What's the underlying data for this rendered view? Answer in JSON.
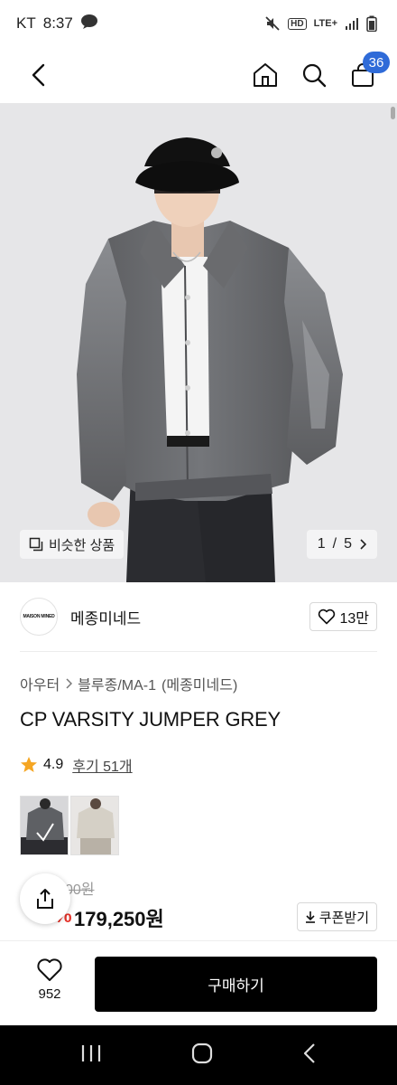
{
  "status_bar": {
    "carrier": "KT",
    "time": "8:37",
    "network": "LTE+",
    "hd": "HD"
  },
  "nav": {
    "cart_count": "36"
  },
  "hero": {
    "similar_label": "비슷한 상품",
    "page_current": "1",
    "page_sep": "/",
    "page_total": "5"
  },
  "brand": {
    "logo_text": "MAISON MINED",
    "name": "메종미네드",
    "like_count": "13만"
  },
  "breadcrumb": {
    "category": "아우터",
    "subcategory": "블루종/MA-1",
    "brand": "(메종미네드)"
  },
  "product": {
    "title": "CP VARSITY JUMPER GREY",
    "rating": "4.9",
    "review_label": "후기 51개",
    "thumbnails": [
      "grey-jacket",
      "beige-jacket"
    ]
  },
  "price": {
    "original_visible": "00원",
    "discount_visible": "%",
    "sale": "179,250원",
    "coupon_label": "쿠폰받기"
  },
  "bottom": {
    "wish_count": "952",
    "buy_label": "구매하기"
  },
  "colors": {
    "accent_blue": "#2f6bd8",
    "discount_red": "#e5332a",
    "star": "#f5a623",
    "buy_bg": "#000000"
  }
}
